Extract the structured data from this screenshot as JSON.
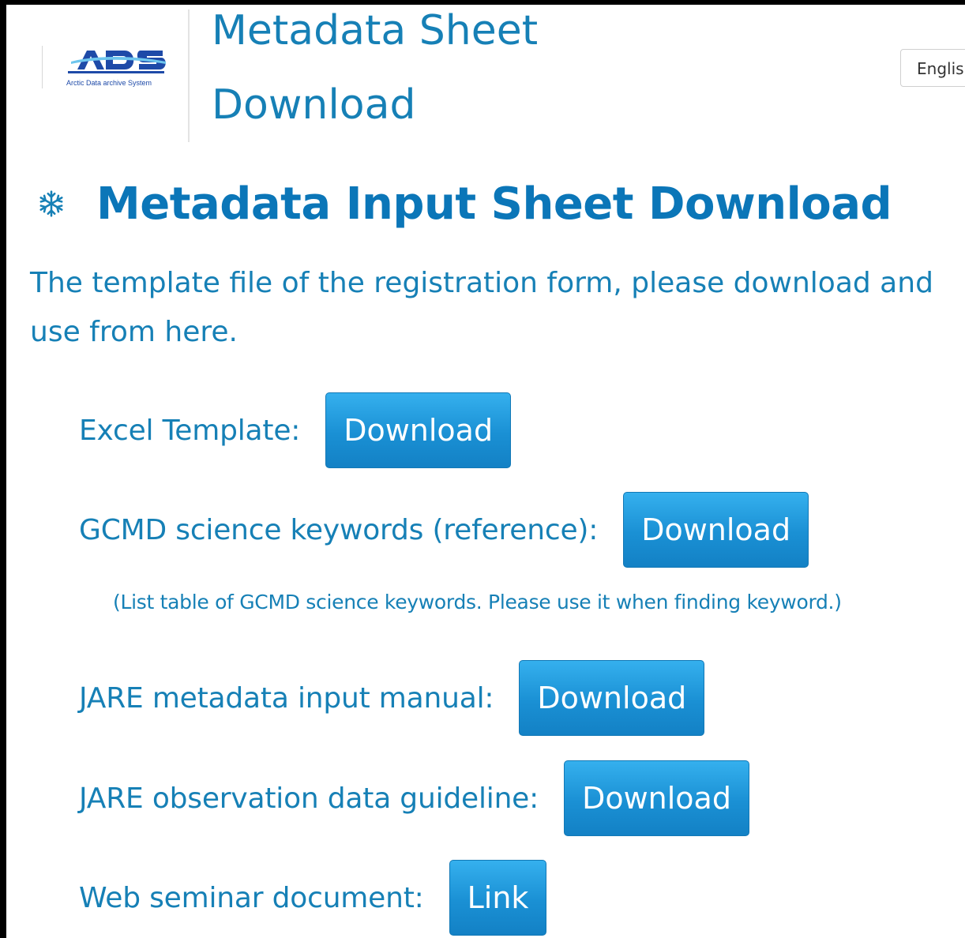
{
  "header": {
    "logo_alt": "ADS",
    "logo_subtitle": "Arctic Data archive System",
    "site_title": "Metadata Sheet Download",
    "language": "English"
  },
  "main": {
    "heading": "Metadata Input Sheet Download",
    "intro": "The template file of the registration form, please download and use from here.",
    "rows": [
      {
        "label": "Excel Template:",
        "button": "Download"
      },
      {
        "label": "GCMD science keywords (reference):",
        "button": "Download",
        "note": "(List table of GCMD science keywords. Please use it when finding keyword.)"
      },
      {
        "label": "JARE metadata input manual:",
        "button": "Download"
      },
      {
        "label": "JARE observation data guideline:",
        "button": "Download"
      },
      {
        "label": "Web seminar document:",
        "button": "Link"
      }
    ]
  },
  "colors": {
    "text_blue": "#1680b6",
    "heading_blue": "#0b76b8",
    "button_blue": "#1a90d4"
  },
  "icons": {
    "heading_icon": "snowflake-icon"
  }
}
